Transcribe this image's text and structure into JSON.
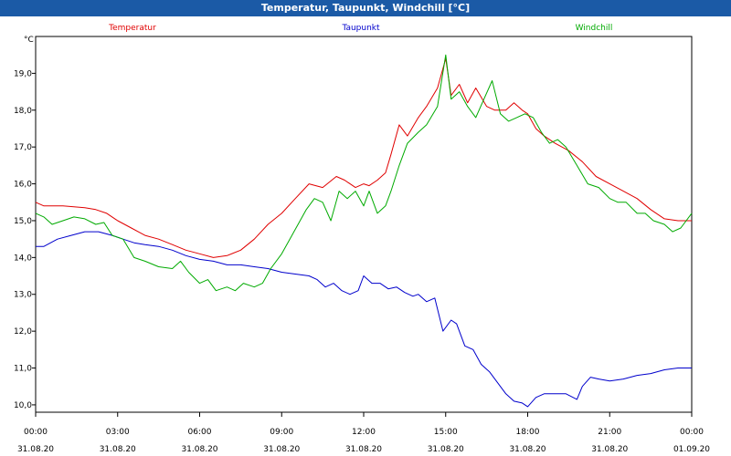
{
  "window": {
    "title": "Temperatur, Taupunkt, Windchill [°C]"
  },
  "chart_data": {
    "type": "line",
    "title": "Temperatur, Taupunkt, Windchill [°C]",
    "ylabel": "°C",
    "ylim": [
      9.8,
      20.0
    ],
    "yticks": [
      10.0,
      11.0,
      12.0,
      13.0,
      14.0,
      15.0,
      16.0,
      17.0,
      18.0,
      19.0
    ],
    "ytick_labels": [
      "10,0",
      "11,0",
      "12,0",
      "13,0",
      "14,0",
      "15,0",
      "16,0",
      "17,0",
      "18,0",
      "19,0"
    ],
    "xlim": [
      0,
      24
    ],
    "xticks": [
      0,
      3,
      6,
      9,
      12,
      15,
      18,
      21,
      24
    ],
    "xtick_labels": [
      [
        "00:00",
        "31.08.20"
      ],
      [
        "03:00",
        "31.08.20"
      ],
      [
        "06:00",
        "31.08.20"
      ],
      [
        "09:00",
        "31.08.20"
      ],
      [
        "12:00",
        "31.08.20"
      ],
      [
        "15:00",
        "31.08.20"
      ],
      [
        "18:00",
        "31.08.20"
      ],
      [
        "21:00",
        "31.08.20"
      ],
      [
        "00:00",
        "01.09.20"
      ]
    ],
    "grid": true,
    "legend_placement": "top",
    "series": [
      {
        "name": "Temperatur",
        "color": "#e00000",
        "x": [
          0,
          0.3,
          1.0,
          1.8,
          2.2,
          2.6,
          3.0,
          3.5,
          4.0,
          4.5,
          5.0,
          5.5,
          6.0,
          6.5,
          7.0,
          7.5,
          8.0,
          8.5,
          9.0,
          9.5,
          10.0,
          10.5,
          11.0,
          11.3,
          11.7,
          12.0,
          12.2,
          12.5,
          12.8,
          13.0,
          13.3,
          13.6,
          14.0,
          14.3,
          14.7,
          15.0,
          15.2,
          15.5,
          15.8,
          16.1,
          16.5,
          16.8,
          17.2,
          17.5,
          17.8,
          18.0,
          18.3,
          18.6,
          19.0,
          19.5,
          20.0,
          20.5,
          21.0,
          21.5,
          22.0,
          22.5,
          23.0,
          23.5,
          24.0
        ],
        "y": [
          15.5,
          15.4,
          15.4,
          15.35,
          15.3,
          15.2,
          15.0,
          14.8,
          14.6,
          14.5,
          14.35,
          14.2,
          14.1,
          14.0,
          14.05,
          14.2,
          14.5,
          14.9,
          15.2,
          15.6,
          16.0,
          15.9,
          16.2,
          16.1,
          15.9,
          16.0,
          15.95,
          16.1,
          16.3,
          16.8,
          17.6,
          17.3,
          17.8,
          18.1,
          18.6,
          19.4,
          18.4,
          18.7,
          18.2,
          18.6,
          18.1,
          18.0,
          18.0,
          18.2,
          18.0,
          17.9,
          17.5,
          17.3,
          17.1,
          16.9,
          16.6,
          16.2,
          16.0,
          15.8,
          15.6,
          15.3,
          15.05,
          15.0,
          15.0
        ]
      },
      {
        "name": "Taupunkt",
        "color": "#0000cc",
        "x": [
          0,
          0.3,
          0.8,
          1.3,
          1.8,
          2.3,
          2.8,
          3.2,
          3.6,
          4.0,
          4.5,
          5.0,
          5.5,
          6.0,
          6.5,
          7.0,
          7.5,
          8.0,
          8.5,
          9.0,
          9.5,
          10.0,
          10.3,
          10.6,
          10.9,
          11.2,
          11.5,
          11.8,
          12.0,
          12.3,
          12.6,
          12.9,
          13.2,
          13.5,
          13.8,
          14.0,
          14.3,
          14.6,
          14.9,
          15.2,
          15.4,
          15.7,
          16.0,
          16.3,
          16.6,
          16.9,
          17.2,
          17.5,
          17.8,
          18.0,
          18.3,
          18.6,
          19.0,
          19.4,
          19.8,
          20.0,
          20.3,
          20.6,
          21.0,
          21.5,
          22.0,
          22.5,
          23.0,
          23.5,
          24.0
        ],
        "y": [
          14.3,
          14.3,
          14.5,
          14.6,
          14.7,
          14.7,
          14.6,
          14.5,
          14.4,
          14.35,
          14.3,
          14.2,
          14.05,
          13.95,
          13.9,
          13.8,
          13.8,
          13.75,
          13.7,
          13.6,
          13.55,
          13.5,
          13.4,
          13.2,
          13.3,
          13.1,
          13.0,
          13.1,
          13.5,
          13.3,
          13.3,
          13.15,
          13.2,
          13.05,
          12.95,
          13.0,
          12.8,
          12.9,
          12.0,
          12.3,
          12.2,
          11.6,
          11.5,
          11.1,
          10.9,
          10.6,
          10.3,
          10.1,
          10.05,
          9.95,
          10.2,
          10.3,
          10.3,
          10.3,
          10.15,
          10.5,
          10.75,
          10.7,
          10.65,
          10.7,
          10.8,
          10.85,
          10.95,
          11.0,
          11.0
        ]
      },
      {
        "name": "Windchill",
        "color": "#00aa00",
        "x": [
          0,
          0.3,
          0.6,
          1.0,
          1.4,
          1.8,
          2.2,
          2.5,
          2.8,
          3.2,
          3.6,
          4.0,
          4.5,
          5.0,
          5.3,
          5.6,
          6.0,
          6.3,
          6.6,
          7.0,
          7.3,
          7.6,
          8.0,
          8.3,
          8.6,
          9.0,
          9.3,
          9.6,
          9.9,
          10.2,
          10.5,
          10.8,
          11.1,
          11.4,
          11.7,
          12.0,
          12.2,
          12.5,
          12.8,
          13.0,
          13.3,
          13.6,
          14.0,
          14.3,
          14.7,
          15.0,
          15.2,
          15.5,
          15.8,
          16.1,
          16.4,
          16.7,
          17.0,
          17.3,
          17.6,
          17.9,
          18.2,
          18.5,
          18.8,
          19.1,
          19.4,
          19.8,
          20.2,
          20.6,
          21.0,
          21.3,
          21.6,
          22.0,
          22.3,
          22.6,
          23.0,
          23.3,
          23.6,
          24.0
        ],
        "y": [
          15.2,
          15.1,
          14.9,
          15.0,
          15.1,
          15.05,
          14.9,
          14.95,
          14.6,
          14.5,
          14.0,
          13.9,
          13.75,
          13.7,
          13.9,
          13.6,
          13.3,
          13.4,
          13.1,
          13.2,
          13.1,
          13.3,
          13.2,
          13.3,
          13.7,
          14.1,
          14.5,
          14.9,
          15.3,
          15.6,
          15.5,
          15.0,
          15.8,
          15.6,
          15.8,
          15.4,
          15.8,
          15.2,
          15.4,
          15.8,
          16.5,
          17.1,
          17.4,
          17.6,
          18.1,
          19.5,
          18.3,
          18.5,
          18.1,
          17.8,
          18.3,
          18.8,
          17.9,
          17.7,
          17.8,
          17.9,
          17.8,
          17.4,
          17.1,
          17.2,
          17.0,
          16.5,
          16.0,
          15.9,
          15.6,
          15.5,
          15.5,
          15.2,
          15.2,
          15.0,
          14.9,
          14.7,
          14.8,
          15.2
        ]
      }
    ]
  }
}
